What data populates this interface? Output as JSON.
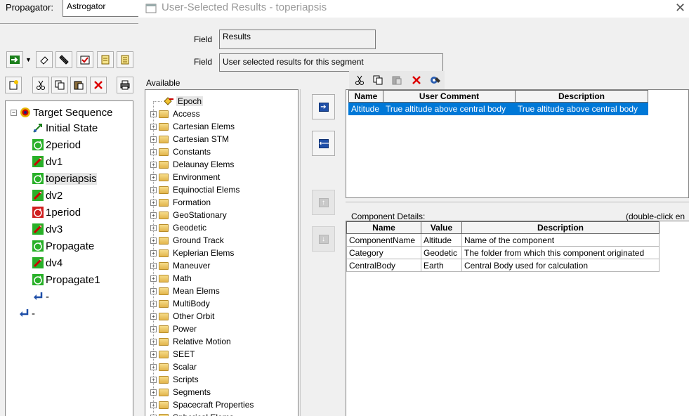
{
  "left": {
    "propagator_label": "Propagator:",
    "propagator_value": "Astrogator",
    "tree": [
      {
        "label": "Target Sequence",
        "icon": "target-sequence-icon"
      },
      {
        "label": "Initial State",
        "icon": "initial-state-icon"
      },
      {
        "label": "2period",
        "icon": "propagate-icon"
      },
      {
        "label": "dv1",
        "icon": "maneuver-icon"
      },
      {
        "label": "toperiapsis",
        "icon": "propagate-icon"
      },
      {
        "label": "dv2",
        "icon": "maneuver-icon"
      },
      {
        "label": "1period",
        "icon": "propagate-red-icon"
      },
      {
        "label": "dv3",
        "icon": "maneuver-icon"
      },
      {
        "label": "Propagate",
        "icon": "propagate-icon"
      },
      {
        "label": "dv4",
        "icon": "maneuver-icon"
      },
      {
        "label": "Propagate1",
        "icon": "propagate-icon"
      },
      {
        "label": "-",
        "icon": "return-icon"
      },
      {
        "label": "-",
        "icon": "return-icon"
      }
    ]
  },
  "dialog": {
    "title": "User-Selected Results - toperiapsis",
    "field_label_1": "Field",
    "field_value_1": "Results",
    "field_label_2": "Field",
    "field_value_2": "User selected results for this segment",
    "available_label": "Available",
    "available_items": [
      "Epoch",
      "Access",
      "Cartesian Elems",
      "Cartesian STM",
      "Constants",
      "Delaunay Elems",
      "Environment",
      "Equinoctial Elems",
      "Formation",
      "GeoStationary",
      "Geodetic",
      "Ground Track",
      "Keplerian Elems",
      "Maneuver",
      "Math",
      "Mean Elems",
      "MultiBody",
      "Other Orbit",
      "Power",
      "Relative Motion",
      "SEET",
      "Scalar",
      "Scripts",
      "Segments",
      "Spacecraft Properties",
      "Spherical Elems"
    ],
    "results_table": {
      "headers": [
        "Name",
        "User Comment",
        "Description"
      ],
      "rows": [
        [
          "Altitude",
          "True altitude above central body",
          "True altitude above central body"
        ]
      ]
    },
    "component_details_label": "Component Details:",
    "component_hint": "(double-click en",
    "component_table": {
      "headers": [
        "Name",
        "Value",
        "Description"
      ],
      "rows": [
        [
          "ComponentName",
          "Altitude",
          "Name of the component"
        ],
        [
          "Category",
          "Geodetic",
          "The folder from which this component originated"
        ],
        [
          "CentralBody",
          "Earth",
          "Central Body used for calculation"
        ]
      ]
    }
  },
  "colors": {
    "selection": "#0078d7",
    "arrow_button": "#1f4fa8"
  }
}
